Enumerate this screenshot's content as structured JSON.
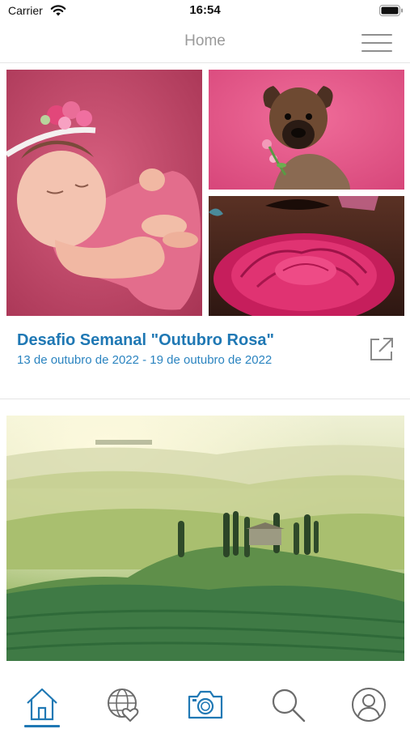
{
  "status_bar": {
    "carrier": "Carrier",
    "time": "16:54",
    "icons": [
      "wifi-icon",
      "battery-icon"
    ]
  },
  "nav": {
    "title": "Home",
    "menu_icon": "hamburger-menu-icon"
  },
  "challenge_card": {
    "title": "Desafio Semanal \"Outubro Rosa\"",
    "dates": "13 de outubro de 2022 - 19 de outubro de 2022",
    "link_icon": "external-link-icon",
    "photos": [
      "baby-photo",
      "puppy-photo",
      "rose-photo"
    ]
  },
  "second_card": {
    "photo": "tuscany-landscape-photo"
  },
  "tab_bar": {
    "active": "home",
    "tabs": [
      "home-icon",
      "explore-globe-heart-icon",
      "camera-icon",
      "search-icon",
      "profile-icon"
    ]
  },
  "colors": {
    "accent": "#1f78b4",
    "nav_title": "#9a9a9a",
    "tab_icon": "#6b6b6b",
    "pink": "#e8588a"
  }
}
